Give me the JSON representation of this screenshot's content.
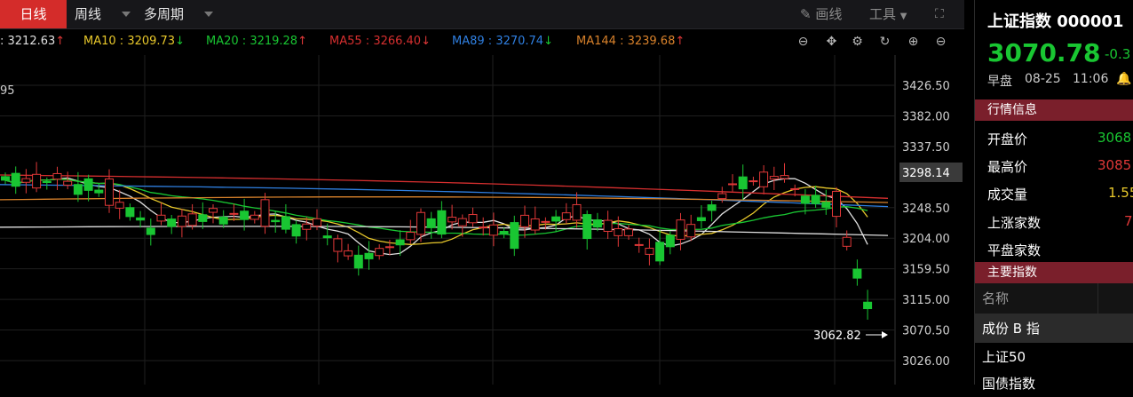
{
  "toolbar": {
    "periods": [
      {
        "label": "日线",
        "active": true
      },
      {
        "label": "周线",
        "active": false
      },
      {
        "label": "多周期",
        "active": false
      }
    ],
    "draw_label": "画线",
    "tools_label": "工具"
  },
  "ma": [
    {
      "label": "",
      "value": "3212.63",
      "trend": "↑",
      "color": "#e0e0e0"
    },
    {
      "label": "MA10",
      "value": "3209.73",
      "trend": "↓",
      "color": "#e8c82b"
    },
    {
      "label": "MA20",
      "value": "3219.28",
      "trend": "↑",
      "color": "#19c632"
    },
    {
      "label": "MA55",
      "value": "3266.40",
      "trend": "↓",
      "color": "#d62f2f"
    },
    {
      "label": "MA89",
      "value": "3270.74",
      "trend": "↓",
      "color": "#2f7fe0"
    },
    {
      "label": "MA144",
      "value": "3239.68",
      "trend": "↑",
      "color": "#d9822b"
    }
  ],
  "chart_data": {
    "type": "candlestick",
    "left_edge_label": "95",
    "y_ticks": [
      "3426.50",
      "3382.00",
      "3337.50",
      "3298.14",
      "3248.50",
      "3204.00",
      "3159.50",
      "3115.00",
      "3070.50",
      "3026.00"
    ],
    "current_price_tag": "3298.14",
    "low_marker": "3062.82",
    "ylim": [
      3026.0,
      3426.5
    ]
  },
  "panel": {
    "title": "上证指数 000001",
    "price": "3070.78",
    "change": "-0.3",
    "session": "早盘",
    "date": "08-25",
    "time": "11:06",
    "market_section": "行情信息",
    "rows": [
      {
        "label": "开盘价",
        "value": "3068",
        "color": "#19c632"
      },
      {
        "label": "最高价",
        "value": "3085",
        "color": "#e03838"
      },
      {
        "label": "成交量",
        "value": "1.55",
        "color": "#e8c82b"
      },
      {
        "label": "上涨家数",
        "value": "7",
        "color": "#e03838"
      },
      {
        "label": "平盘家数",
        "value": "",
        "color": "#ffffff"
      }
    ],
    "index_section": "主要指数",
    "index_header": "名称",
    "indices": [
      "成份 B 指",
      "上证50",
      "国债指数"
    ]
  },
  "colors": {
    "up": "#e03838",
    "down": "#19c632",
    "accent": "#d42c2a"
  }
}
